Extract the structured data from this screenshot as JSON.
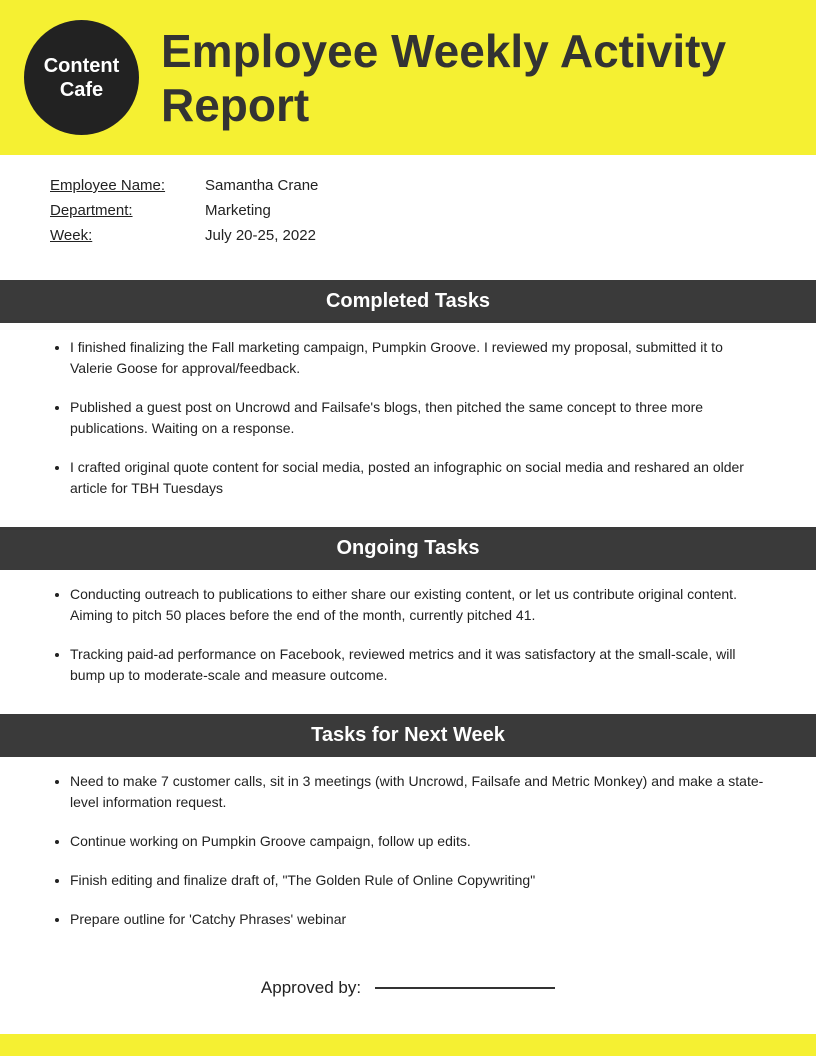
{
  "header": {
    "logo_line1": "Content",
    "logo_line2": "Cafe",
    "title": "Employee Weekly Activity Report"
  },
  "info": {
    "employee_name_label": "Employee Name:",
    "employee_name_value": "Samantha Crane",
    "department_label": "Department:",
    "department_value": "Marketing",
    "week_label": "Week:",
    "week_value": "July 20-25, 2022"
  },
  "completed_tasks": {
    "heading": "Completed Tasks",
    "items": [
      "I finished finalizing the Fall marketing campaign, Pumpkin Groove. I reviewed my proposal, submitted it to Valerie Goose for approval/feedback.",
      "Published a guest post on Uncrowd and Failsafe's blogs, then pitched the same concept to three more publications. Waiting on a response.",
      "I crafted original quote content for social media, posted an infographic on social media and reshared an older article for TBH Tuesdays"
    ]
  },
  "ongoing_tasks": {
    "heading": "Ongoing Tasks",
    "items": [
      "Conducting outreach to publications to either share our existing content, or let us contribute original content. Aiming to pitch 50 places before the end of the month, currently pitched 41.",
      "Tracking paid-ad performance on Facebook, reviewed metrics and it was satisfactory at the small-scale, will bump up to moderate-scale and measure outcome."
    ]
  },
  "next_week_tasks": {
    "heading": "Tasks for Next Week",
    "items": [
      "Need to make 7 customer calls, sit in 3 meetings (with Uncrowd, Failsafe and Metric Monkey) and make a state-level information request.",
      "Continue working on Pumpkin Groove campaign, follow up edits.",
      "Finish editing and finalize draft of, \"The Golden Rule of Online Copywriting\"",
      "Prepare outline for 'Catchy Phrases' webinar"
    ]
  },
  "approved": {
    "label": "Approved by:"
  }
}
